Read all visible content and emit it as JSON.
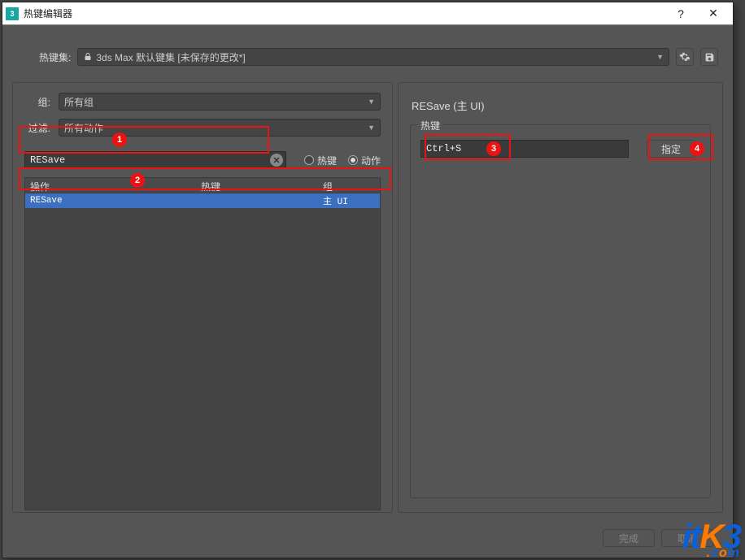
{
  "titlebar": {
    "title": "热键编辑器"
  },
  "hkset": {
    "label": "热键集:",
    "value": "3ds Max 默认键集 [未保存的更改*]"
  },
  "left": {
    "group_label": "组:",
    "group_value": "所有组",
    "filter_label": "过滤:",
    "filter_value": "所有动作",
    "search_value": "RESave",
    "radio_hotkey": "热键",
    "radio_action": "动作",
    "col_op": "操作",
    "col_hk": "热键",
    "col_grp": "组",
    "rows": [
      {
        "op": "RESave",
        "hk": "",
        "grp": "主 UI"
      }
    ]
  },
  "right": {
    "title": "RESave (主 UI)",
    "legend": "热键",
    "hotkey_value": "Ctrl+S",
    "assign": "指定"
  },
  "footer": {
    "ok": "完成",
    "cancel": "取消"
  },
  "callouts": {
    "c1": "1",
    "c2": "2",
    "c3": "3",
    "c4": "4"
  },
  "watermark": {
    "t1": "it",
    "t2": "K",
    "t3": "3",
    "dot": ".",
    "t4": "c",
    "t5": "o",
    "t6": "m"
  }
}
